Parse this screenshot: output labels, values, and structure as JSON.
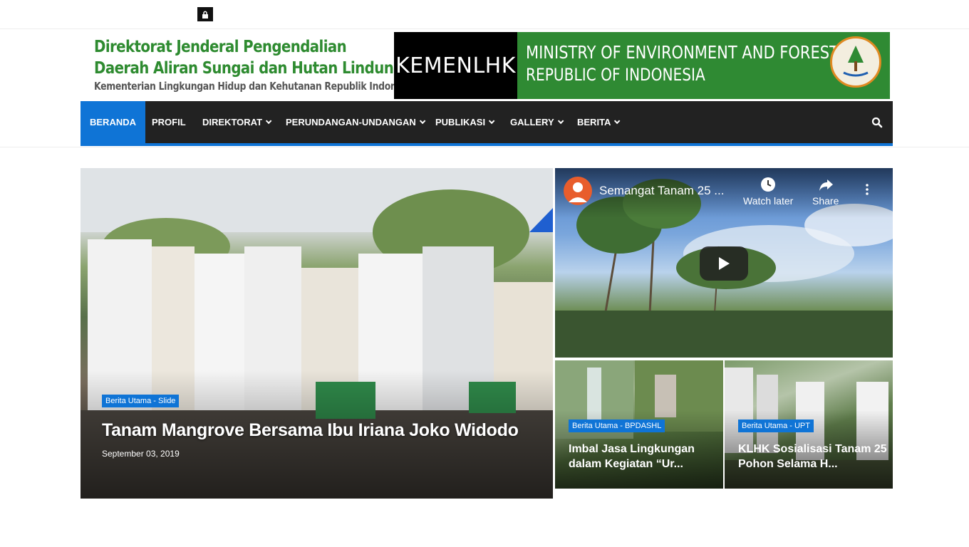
{
  "header": {
    "logo_line1": "Direktorat Jenderal Pengendalian",
    "logo_line2": "Daerah Aliran Sungai dan Hutan Lindung",
    "logo_line3": "Kementerian Lingkungan Hidup dan Kehutanan Republik Indonesia",
    "banner_left": "KEMENLHK",
    "banner_line1": "MINISTRY OF ENVIRONMENT AND FORESTRY",
    "banner_line2": "REPUBLIC OF INDONESIA"
  },
  "nav": {
    "items": [
      {
        "label": "BERANDA"
      },
      {
        "label": "PROFIL"
      },
      {
        "label": "DIREKTORAT"
      },
      {
        "label": "PERUNDANGAN-UNDANGAN"
      },
      {
        "label": "PUBLIKASI"
      },
      {
        "label": "GALLERY"
      },
      {
        "label": "BERITA"
      }
    ]
  },
  "slide": {
    "tag": "Berita Utama - Slide",
    "title": "Tanam Mangrove Bersama Ibu Iriana Joko Widodo",
    "date": "September 03, 2019"
  },
  "video": {
    "title": "Semangat Tanam 25 ...",
    "watch_later": "Watch later",
    "share": "Share"
  },
  "cards": [
    {
      "tag": "Berita Utama - BPDASHL",
      "title": "Imbal Jasa Lingkungan dalam Kegiatan “Ur..."
    },
    {
      "tag": "Berita Utama - UPT",
      "title": "KLHK Sosialisasi Tanam 25 Pohon Selama H..."
    }
  ],
  "colors": {
    "accent": "#0f74d6",
    "nav_bg": "#222222",
    "brand_green": "#2f8a33"
  }
}
